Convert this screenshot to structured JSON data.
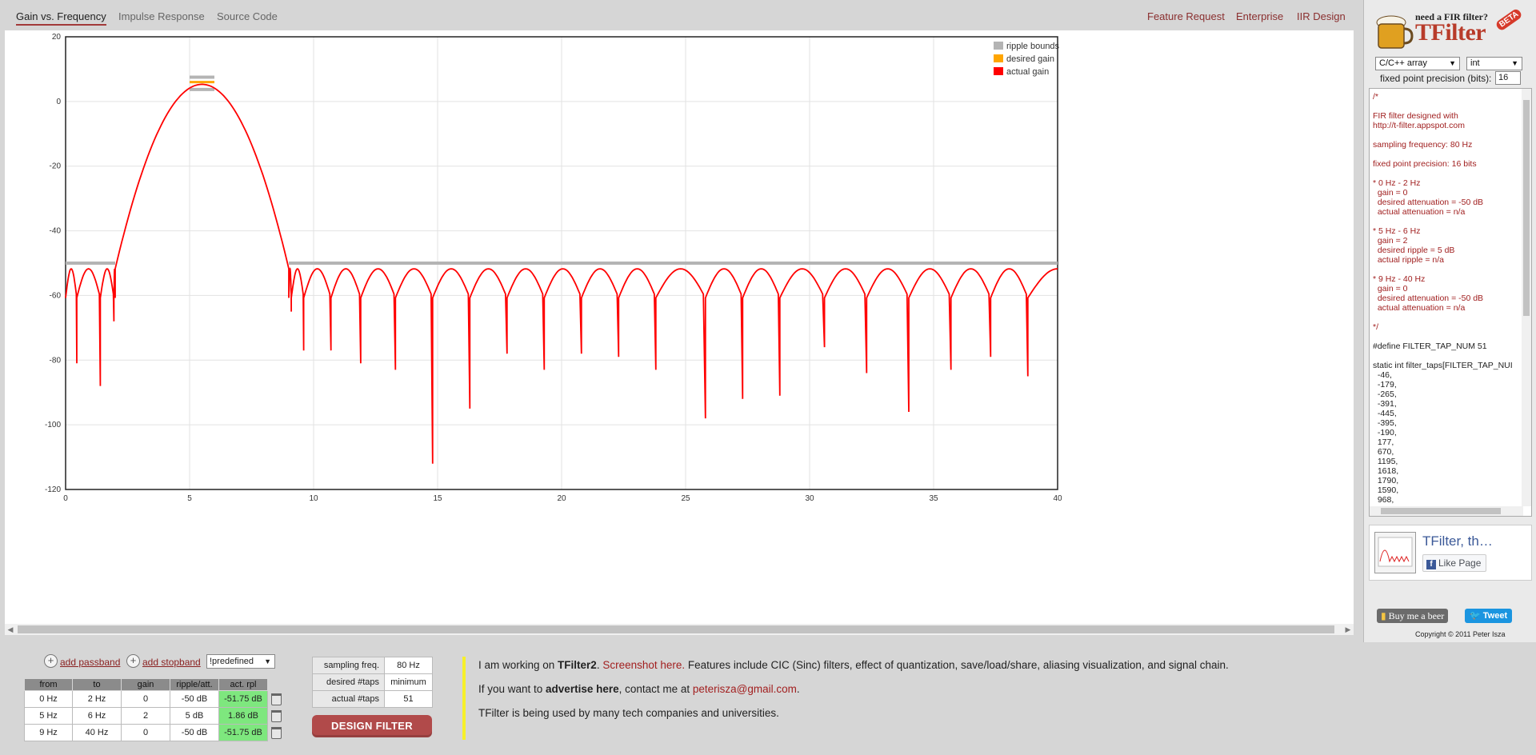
{
  "tabs": [
    {
      "label": "Gain vs. Frequency",
      "active": true
    },
    {
      "label": "Impulse Response",
      "active": false
    },
    {
      "label": "Source Code",
      "active": false
    }
  ],
  "header_links": [
    "Feature Request",
    "Enterprise",
    "IIR Design"
  ],
  "chart_data": {
    "type": "line",
    "xlim": [
      0,
      40
    ],
    "ylim": [
      -120,
      20
    ],
    "x_ticks": [
      0,
      5,
      10,
      15,
      20,
      25,
      30,
      35,
      40
    ],
    "y_ticks": [
      20,
      0,
      -20,
      -40,
      -60,
      -80,
      -100,
      -120
    ],
    "grid": true,
    "legend_position": "top-right",
    "legend": [
      {
        "label": "ripple bounds",
        "color": "#b4b4b4"
      },
      {
        "label": "desired gain",
        "color": "#ffa500"
      },
      {
        "label": "actual gain",
        "color": "#ff0000"
      }
    ],
    "ripple_bounds": [
      {
        "x": [
          5,
          6
        ],
        "y": 7.5
      },
      {
        "x": [
          5,
          6
        ],
        "y": 3.7
      },
      {
        "x": [
          0,
          2
        ],
        "y": -50
      },
      {
        "x": [
          9,
          40
        ],
        "y": -50
      }
    ],
    "desired_gain": [
      {
        "x": [
          5,
          6
        ],
        "y": 6.0
      }
    ],
    "actual_gain": {
      "stopband_ripple_level": -51.75,
      "passband_peak": 5.3,
      "main_lobe": [
        2.0,
        9.0
      ],
      "stopband_nulls": [
        {
          "x": 0.45,
          "y": -81
        },
        {
          "x": 1.4,
          "y": -88
        },
        {
          "x": 1.95,
          "y": -68
        },
        {
          "x": 9.1,
          "y": -65
        },
        {
          "x": 9.6,
          "y": -77
        },
        {
          "x": 10.7,
          "y": -77
        },
        {
          "x": 11.9,
          "y": -81
        },
        {
          "x": 13.3,
          "y": -83
        },
        {
          "x": 14.8,
          "y": -112
        },
        {
          "x": 16.3,
          "y": -95
        },
        {
          "x": 17.8,
          "y": -78
        },
        {
          "x": 19.3,
          "y": -83
        },
        {
          "x": 20.8,
          "y": -78
        },
        {
          "x": 22.3,
          "y": -79
        },
        {
          "x": 23.8,
          "y": -83
        },
        {
          "x": 25.8,
          "y": -98
        },
        {
          "x": 27.3,
          "y": -92
        },
        {
          "x": 28.8,
          "y": -91
        },
        {
          "x": 30.6,
          "y": -76
        },
        {
          "x": 32.3,
          "y": -84
        },
        {
          "x": 34.0,
          "y": -96
        },
        {
          "x": 35.7,
          "y": -83
        },
        {
          "x": 37.3,
          "y": -79
        },
        {
          "x": 38.8,
          "y": -85
        }
      ]
    }
  },
  "sidebar": {
    "logo_tagline": "need a FIR filter?",
    "logo_name": "TFilter",
    "logo_badge": "BETA",
    "output_format": "C/C++ array",
    "data_type": "int",
    "precision_label": "fixed point precision (bits):",
    "precision_value": "16",
    "code_comment": "/*\n\nFIR filter designed with\nhttp://t-filter.appspot.com\n\nsampling frequency: 80 Hz\n\nfixed point precision: 16 bits\n\n* 0 Hz - 2 Hz\n  gain = 0\n  desired attenuation = -50 dB\n  actual attenuation = n/a\n\n* 5 Hz - 6 Hz\n  gain = 2\n  desired ripple = 5 dB\n  actual ripple = n/a\n\n* 9 Hz - 40 Hz\n  gain = 0\n  desired attenuation = -50 dB\n  actual attenuation = n/a\n\n*/\n",
    "code_body": "\n#define FILTER_TAP_NUM 51\n\nstatic int filter_taps[FILTER_TAP_NUI\n  -46,\n  -179,\n  -265,\n  -391,\n  -445,\n  -395,\n  -190,\n  177,\n  670,\n  1195,\n  1618,\n  1790,\n  1590,\n  968,",
    "fb_title": "TFilter, th…",
    "fb_like": "Like Page",
    "beer_button": "Buy me a beer",
    "tweet_button": "Tweet",
    "copyright": "Copyright © 2011 Peter Isza"
  },
  "controls": {
    "add_passband": "add passband",
    "add_stopband": "add stopband",
    "predefined": "!predefined",
    "band_headers": [
      "from",
      "to",
      "gain",
      "ripple/att.",
      "act. rpl"
    ],
    "bands": [
      [
        "0 Hz",
        "2 Hz",
        "0",
        "-50 dB",
        "-51.75 dB"
      ],
      [
        "5 Hz",
        "6 Hz",
        "2",
        "5 dB",
        "1.86 dB"
      ],
      [
        "9 Hz",
        "40 Hz",
        "0",
        "-50 dB",
        "-51.75 dB"
      ]
    ],
    "params": [
      {
        "label": "sampling freq.",
        "value": "80 Hz"
      },
      {
        "label": "desired #taps",
        "value": "minimum"
      },
      {
        "label": "actual #taps",
        "value": "51"
      }
    ],
    "design_button": "DESIGN FILTER"
  },
  "info": {
    "p1_a": "I am working on ",
    "p1_bold": "TFilter2",
    "p1_b": ". ",
    "p1_link": "Screenshot here.",
    "p1_c": " Features include CIC (Sinc) filters, effect of quantization, save/load/share, aliasing visualization, and signal chain.",
    "p2_a": "If you want to ",
    "p2_bold": "advertise here",
    "p2_b": ", contact me at ",
    "p2_email": "peterisza@gmail.com",
    "p2_c": ".",
    "p3": "TFilter is being used by many tech companies and universities."
  }
}
